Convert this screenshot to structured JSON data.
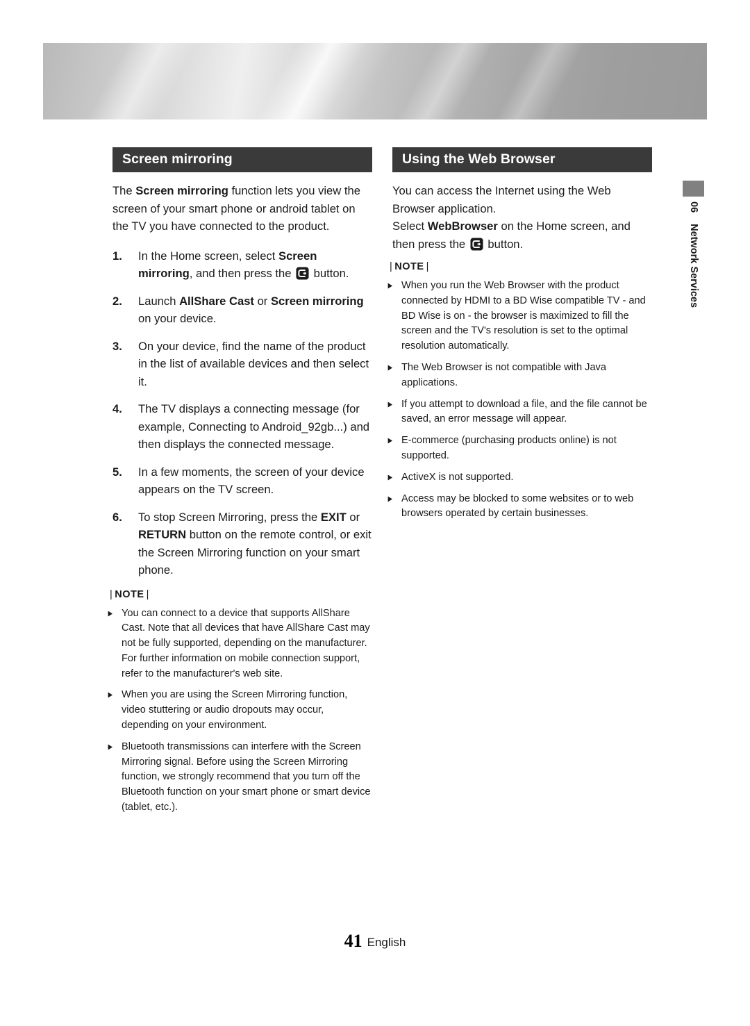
{
  "page": {
    "number": "41",
    "language": "English",
    "chapter_number": "06",
    "chapter_title": "Network Services",
    "banner_color": "#bdbdbd",
    "header_bar_color": "#3a3a3a",
    "tab_color": "#808080"
  },
  "left_column": {
    "heading": "Screen mirroring",
    "intro": {
      "before": "The ",
      "bold": "Screen mirroring",
      "after": " function lets you view the screen of your smart phone or android tablet on the TV you have connected to the product."
    },
    "steps": [
      {
        "num": "1.",
        "parts": [
          {
            "text": "In the Home screen, select ",
            "bold": false
          },
          {
            "text": "Screen mirroring",
            "bold": true
          },
          {
            "text": ", and then press the ",
            "bold": false
          },
          {
            "icon": "enter-button-icon"
          },
          {
            "text": " button.",
            "bold": false
          }
        ]
      },
      {
        "num": "2.",
        "parts": [
          {
            "text": "Launch ",
            "bold": false
          },
          {
            "text": "AllShare Cast",
            "bold": true
          },
          {
            "text": " or ",
            "bold": false
          },
          {
            "text": "Screen mirroring",
            "bold": true
          },
          {
            "text": " on your device.",
            "bold": false
          }
        ]
      },
      {
        "num": "3.",
        "parts": [
          {
            "text": "On your device, find the name of the product in the list of available devices and then select it.",
            "bold": false
          }
        ]
      },
      {
        "num": "4.",
        "parts": [
          {
            "text": "The TV displays a connecting message (for example, Connecting to Android_92gb...) and then displays the connected message.",
            "bold": false
          }
        ]
      },
      {
        "num": "5.",
        "parts": [
          {
            "text": "In a few moments, the screen of your device appears on the TV screen.",
            "bold": false
          }
        ]
      },
      {
        "num": "6.",
        "parts": [
          {
            "text": "To stop Screen Mirroring, press the ",
            "bold": false
          },
          {
            "text": "EXIT",
            "bold": true
          },
          {
            "text": " or ",
            "bold": false
          },
          {
            "text": "RETURN",
            "bold": true
          },
          {
            "text": " button on the remote control, or exit the Screen Mirroring function on your smart phone.",
            "bold": false
          }
        ]
      }
    ],
    "note_label": "NOTE",
    "notes": [
      "You can connect to a device that supports AllShare Cast. Note that all devices that have AllShare Cast may not be fully supported, depending on the  manufacturer. For further information on mobile connection support, refer to the manufacturer's web site.",
      "When you are using the Screen Mirroring function, video stuttering or audio dropouts may occur, depending on your environment.",
      "Bluetooth transmissions can interfere with the Screen Mirroring signal. Before using the Screen Mirroring function, we strongly recommend that you turn off the Bluetooth function on your smart phone or smart device (tablet, etc.)."
    ]
  },
  "right_column": {
    "heading": "Using the Web Browser",
    "intro": "You can access the Internet using the Web Browser application.",
    "select_line": {
      "parts": [
        {
          "text": "Select ",
          "bold": false
        },
        {
          "text": "WebBrowser",
          "bold": true
        },
        {
          "text": " on the Home screen, and then press the ",
          "bold": false
        },
        {
          "icon": "enter-button-icon"
        },
        {
          "text": " button.",
          "bold": false
        }
      ]
    },
    "note_label": "NOTE",
    "notes": [
      "When you run the Web Browser with the product connected by HDMI to a BD Wise compatible TV - and BD Wise is on - the browser is maximized to fill the screen and the TV's resolution is set to the optimal resolution automatically.",
      "The Web Browser is not compatible with Java applications.",
      "If you attempt to download a file, and the file cannot be saved, an error message will appear.",
      "E-commerce (purchasing products online) is not supported.",
      "ActiveX is not supported.",
      "Access may be blocked to some websites or to web browsers operated by certain businesses."
    ]
  }
}
